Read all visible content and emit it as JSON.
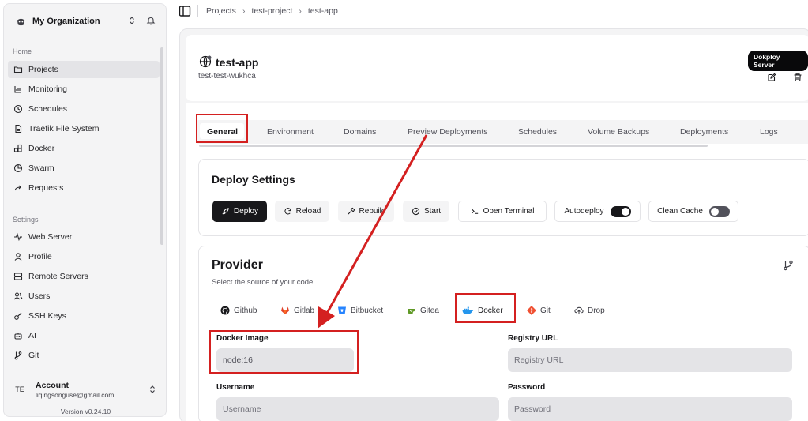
{
  "sidebar": {
    "org_name": "My Organization",
    "groups": {
      "home": "Home",
      "settings": "Settings"
    },
    "home_items": [
      {
        "label": "Projects",
        "icon": "folder-icon",
        "active": true
      },
      {
        "label": "Monitoring",
        "icon": "chart-icon"
      },
      {
        "label": "Schedules",
        "icon": "clock-icon"
      },
      {
        "label": "Traefik File System",
        "icon": "file-icon"
      },
      {
        "label": "Docker",
        "icon": "blocks-icon"
      },
      {
        "label": "Swarm",
        "icon": "pie-icon"
      },
      {
        "label": "Requests",
        "icon": "arrow-icon"
      }
    ],
    "settings_items": [
      {
        "label": "Web Server",
        "icon": "activity-icon"
      },
      {
        "label": "Profile",
        "icon": "user-icon"
      },
      {
        "label": "Remote Servers",
        "icon": "server-icon"
      },
      {
        "label": "Users",
        "icon": "users-icon"
      },
      {
        "label": "SSH Keys",
        "icon": "key-icon"
      },
      {
        "label": "AI",
        "icon": "bot-icon"
      },
      {
        "label": "Git",
        "icon": "git-branch-icon"
      }
    ],
    "account": {
      "initials": "TE",
      "title": "Account",
      "email": "liqingsonguse@gmail.com"
    },
    "version": "Version v0.24.10"
  },
  "breadcrumb": [
    "Projects",
    "test-project",
    "test-app"
  ],
  "app": {
    "title": "test-app",
    "subtitle": "test-test-wukhca",
    "server_badge": "Dokploy Server"
  },
  "tabs": [
    "General",
    "Environment",
    "Domains",
    "Preview Deployments",
    "Schedules",
    "Volume Backups",
    "Deployments",
    "Logs"
  ],
  "deploy": {
    "title": "Deploy Settings",
    "buttons": {
      "deploy": "Deploy",
      "reload": "Reload",
      "rebuild": "Rebuild",
      "start": "Start",
      "terminal": "Open Terminal",
      "autodeploy": "Autodeploy",
      "clean_cache": "Clean Cache"
    },
    "autodeploy_on": true,
    "clean_cache_on": false
  },
  "provider": {
    "title": "Provider",
    "subtitle": "Select the source of your code",
    "tabs": [
      "Github",
      "Gitlab",
      "Bitbucket",
      "Gitea",
      "Docker",
      "Git",
      "Drop"
    ],
    "active_tab": "Docker",
    "fields": {
      "docker_image": {
        "label": "Docker Image",
        "value": "node:16"
      },
      "registry_url": {
        "label": "Registry URL",
        "placeholder": "Registry URL"
      },
      "username": {
        "label": "Username",
        "placeholder": "Username"
      },
      "password": {
        "label": "Password",
        "placeholder": "Password"
      }
    }
  },
  "colors": {
    "accent": "#18181b",
    "annotation": "#d42020",
    "muted": "#f4f4f5"
  }
}
